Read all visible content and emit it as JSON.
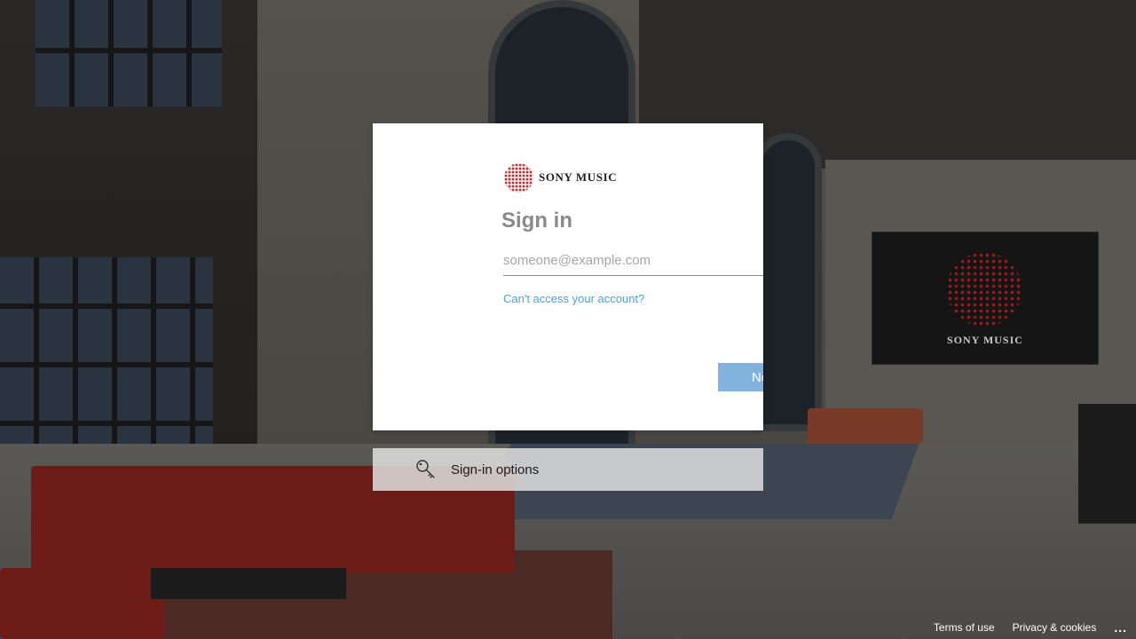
{
  "signin": {
    "brand_name": "SONY MUSIC",
    "title": "Sign in",
    "email_placeholder": "someone@example.com",
    "email_value": "",
    "cant_access_link": "Can't access your account?",
    "next_button": "Next"
  },
  "options": {
    "label": "Sign-in options",
    "icon": "key-icon"
  },
  "footer": {
    "terms": "Terms of use",
    "privacy": "Privacy & cookies",
    "more": "..."
  },
  "background": {
    "screen_brand": "SONY MUSIC"
  },
  "colors": {
    "accent_link": "#4aa3df",
    "next_button_bg": "#82b3de",
    "brand_red": "#d8232a"
  }
}
